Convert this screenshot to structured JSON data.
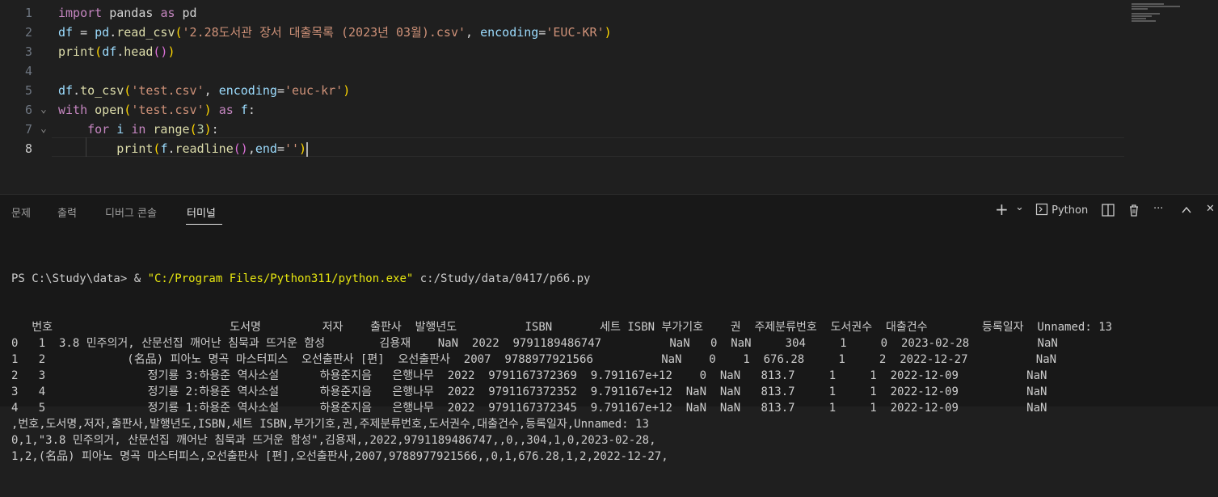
{
  "editor": {
    "line_numbers": [
      "1",
      "2",
      "3",
      "4",
      "5",
      "6",
      "7",
      "8"
    ],
    "lines": [
      {
        "segments": [
          {
            "t": "import",
            "c": "kw"
          },
          {
            "t": " pandas ",
            "c": "pun"
          },
          {
            "t": "as",
            "c": "kw"
          },
          {
            "t": " pd",
            "c": "pun"
          }
        ]
      },
      {
        "segments": [
          {
            "t": "df",
            "c": "var"
          },
          {
            "t": " = ",
            "c": "pun"
          },
          {
            "t": "pd",
            "c": "var"
          },
          {
            "t": ".",
            "c": "pun"
          },
          {
            "t": "read_csv",
            "c": "fn"
          },
          {
            "t": "(",
            "c": "br"
          },
          {
            "t": "'2.28도서관 장서 대출목록 (2023년 03월).csv'",
            "c": "str"
          },
          {
            "t": ", ",
            "c": "pun"
          },
          {
            "t": "encoding",
            "c": "var"
          },
          {
            "t": "=",
            "c": "pun"
          },
          {
            "t": "'EUC-KR'",
            "c": "str"
          },
          {
            "t": ")",
            "c": "br"
          }
        ]
      },
      {
        "segments": [
          {
            "t": "print",
            "c": "fn"
          },
          {
            "t": "(",
            "c": "br"
          },
          {
            "t": "df",
            "c": "var"
          },
          {
            "t": ".",
            "c": "pun"
          },
          {
            "t": "head",
            "c": "fn"
          },
          {
            "t": "()",
            "c": "br2"
          },
          {
            "t": ")",
            "c": "br"
          }
        ]
      },
      {
        "segments": []
      },
      {
        "segments": [
          {
            "t": "df",
            "c": "var"
          },
          {
            "t": ".",
            "c": "pun"
          },
          {
            "t": "to_csv",
            "c": "fn"
          },
          {
            "t": "(",
            "c": "br"
          },
          {
            "t": "'test.csv'",
            "c": "str"
          },
          {
            "t": ", ",
            "c": "pun"
          },
          {
            "t": "encoding",
            "c": "var"
          },
          {
            "t": "=",
            "c": "pun"
          },
          {
            "t": "'euc-kr'",
            "c": "str"
          },
          {
            "t": ")",
            "c": "br"
          }
        ]
      },
      {
        "segments": [
          {
            "t": "with",
            "c": "kw"
          },
          {
            "t": " ",
            "c": "pun"
          },
          {
            "t": "open",
            "c": "fn"
          },
          {
            "t": "(",
            "c": "br"
          },
          {
            "t": "'test.csv'",
            "c": "str"
          },
          {
            "t": ")",
            "c": "br"
          },
          {
            "t": " ",
            "c": "pun"
          },
          {
            "t": "as",
            "c": "kw"
          },
          {
            "t": " ",
            "c": "pun"
          },
          {
            "t": "f",
            "c": "var"
          },
          {
            "t": ":",
            "c": "pun"
          }
        ]
      },
      {
        "segments": [
          {
            "t": "    ",
            "c": "pun"
          },
          {
            "t": "for",
            "c": "kw"
          },
          {
            "t": " ",
            "c": "pun"
          },
          {
            "t": "i",
            "c": "var"
          },
          {
            "t": " ",
            "c": "pun"
          },
          {
            "t": "in",
            "c": "kw"
          },
          {
            "t": " ",
            "c": "pun"
          },
          {
            "t": "range",
            "c": "fn"
          },
          {
            "t": "(",
            "c": "br"
          },
          {
            "t": "3",
            "c": "num"
          },
          {
            "t": ")",
            "c": "br"
          },
          {
            "t": ":",
            "c": "pun"
          }
        ]
      },
      {
        "segments": [
          {
            "t": "        ",
            "c": "pun"
          },
          {
            "t": "print",
            "c": "fn"
          },
          {
            "t": "(",
            "c": "br"
          },
          {
            "t": "f",
            "c": "var"
          },
          {
            "t": ".",
            "c": "pun"
          },
          {
            "t": "readline",
            "c": "fn"
          },
          {
            "t": "()",
            "c": "br2"
          },
          {
            "t": ",",
            "c": "pun"
          },
          {
            "t": "end",
            "c": "var"
          },
          {
            "t": "=",
            "c": "pun"
          },
          {
            "t": "''",
            "c": "str"
          },
          {
            "t": ")",
            "c": "br"
          }
        ]
      }
    ]
  },
  "panel": {
    "tabs": [
      {
        "label": "문제"
      },
      {
        "label": "출력"
      },
      {
        "label": "디버그 콘솔"
      },
      {
        "label": "터미널"
      }
    ],
    "active_tab": "터미널",
    "actions": {
      "add": "+",
      "dropdown": "⌄",
      "terminal_name": "Python",
      "split": "◫",
      "trash": "🗑",
      "more": "···",
      "maximize": "⌃",
      "close": "✕"
    }
  },
  "terminal": {
    "prompt_prefix": "PS C:\\Study\\data> & ",
    "exe_path": "\"C:/Program Files/Python311/python.exe\"",
    "script_arg": " c:/Study/data/0417/p66.py",
    "output_lines": [
      "   번호                          도서명         저자    출판사  발행년도          ISBN       세트 ISBN 부가기호    권  주제분류번호  도서권수  대출건수        등록일자  Unnamed: 13",
      "0   1  3.8 민주의거, 산문선집 깨어난 침묵과 뜨거운 함성        김용재    NaN  2022  9791189486747          NaN   0  NaN     304     1     0  2023-02-28          NaN",
      "1   2            (名品) 피아노 명곡 마스터피스  오선출판사 [편]  오선출판사  2007  9788977921566          NaN    0    1  676.28     1     2  2022-12-27          NaN",
      "2   3               정기룡 3:하용준 역사소설      하용준지음   은행나무  2022  9791167372369  9.791167e+12    0  NaN   813.7     1     1  2022-12-09          NaN",
      "3   4               정기룡 2:하용준 역사소설      하용준지음   은행나무  2022  9791167372352  9.791167e+12  NaN  NaN   813.7     1     1  2022-12-09          NaN",
      "4   5               정기룡 1:하용준 역사소설      하용준지음   은행나무  2022  9791167372345  9.791167e+12  NaN  NaN   813.7     1     1  2022-12-09          NaN",
      ",번호,도서명,저자,출판사,발행년도,ISBN,세트 ISBN,부가기호,권,주제분류번호,도서권수,대출건수,등록일자,Unnamed: 13",
      "0,1,\"3.8 민주의거, 산문선집 깨어난 침묵과 뜨거운 함성\",김용재,,2022,9791189486747,,0,,304,1,0,2023-02-28,",
      "1,2,(名品) 피아노 명곡 마스터피스,오선출판사 [편],오선출판사,2007,9788977921566,,0,1,676.28,1,2,2022-12-27,"
    ]
  }
}
